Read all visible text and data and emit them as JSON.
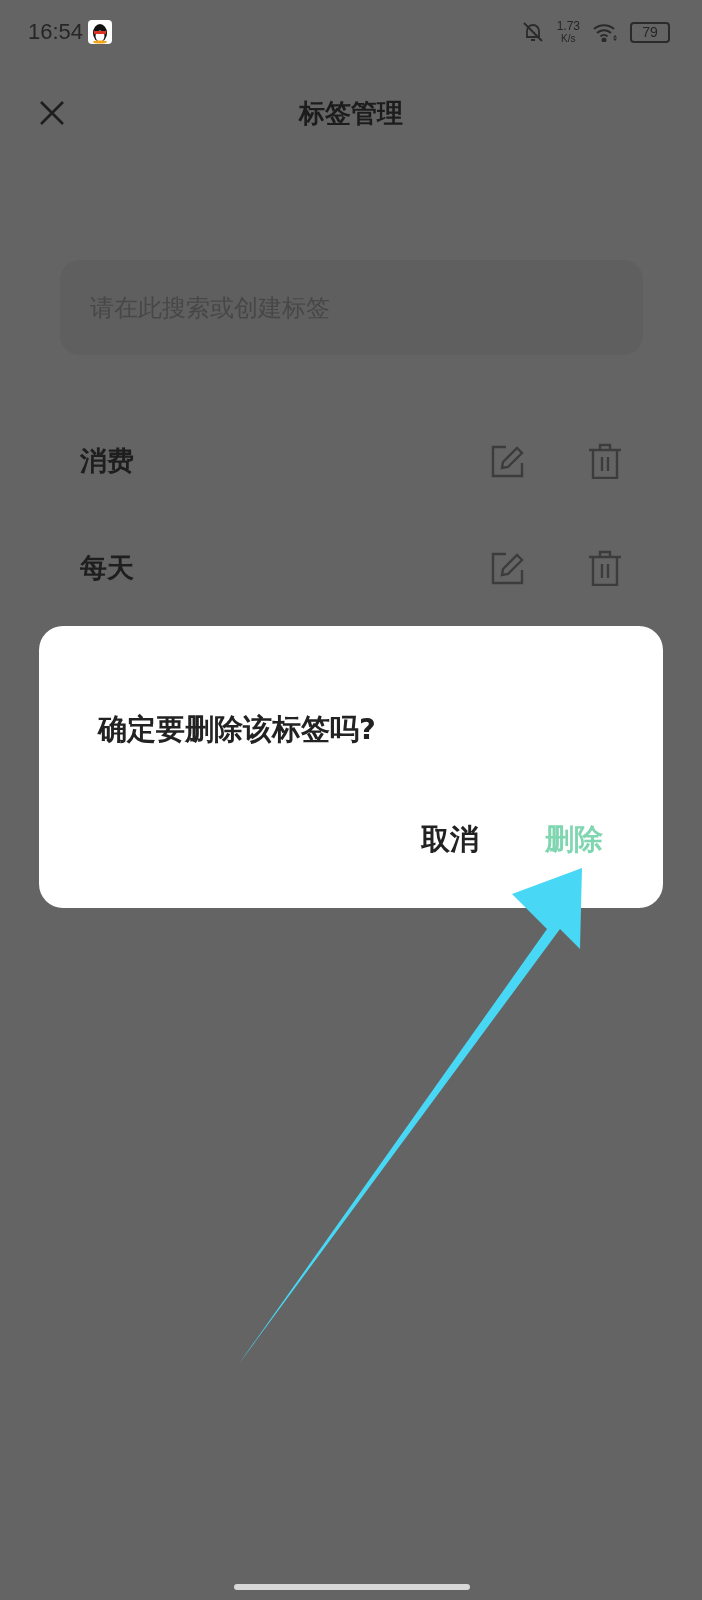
{
  "status_bar": {
    "time": "16:54",
    "network_speed": "1.73",
    "network_speed_unit": "K/s",
    "battery": "79"
  },
  "header": {
    "title": "标签管理"
  },
  "search": {
    "placeholder": "请在此搜索或创建标签"
  },
  "tags": [
    {
      "name": "消费"
    },
    {
      "name": "每天"
    }
  ],
  "dialog": {
    "message": "确定要删除该标签吗?",
    "buttons": [
      {
        "label": "取消",
        "kind": "cancel"
      },
      {
        "label": "删除",
        "kind": "confirm"
      }
    ]
  }
}
